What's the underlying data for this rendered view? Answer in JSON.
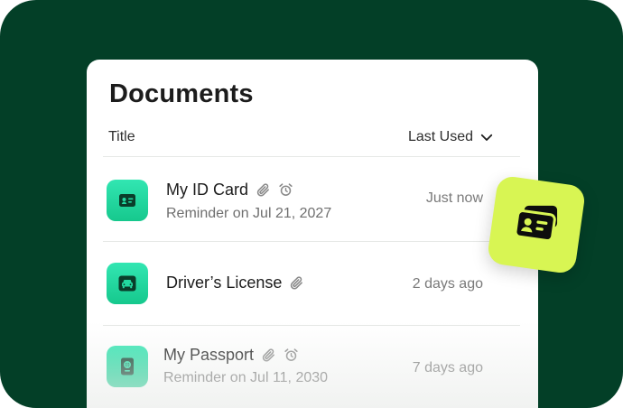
{
  "header": {
    "title": "Documents",
    "column_title": "Title",
    "sort_label": "Last Used"
  },
  "documents": [
    {
      "name": "My ID Card",
      "reminder": "Reminder on Jul 21, 2027",
      "last_used": "Just now",
      "icon": "id-card-icon",
      "has_attachment": true,
      "has_alarm": true
    },
    {
      "name": "Driver’s License",
      "reminder": "",
      "last_used": "2 days ago",
      "icon": "car-icon",
      "has_attachment": true,
      "has_alarm": false
    },
    {
      "name": "My Passport",
      "reminder": "Reminder on Jul 11, 2030",
      "last_used": "7 days ago",
      "icon": "passport-icon",
      "has_attachment": true,
      "has_alarm": true
    }
  ],
  "badge": {
    "icon": "id-cards-icon"
  },
  "colors": {
    "background": "#033f27",
    "panel": "#ffffff",
    "accent_green": "#1fd79f",
    "badge_lime": "#d8f553"
  }
}
